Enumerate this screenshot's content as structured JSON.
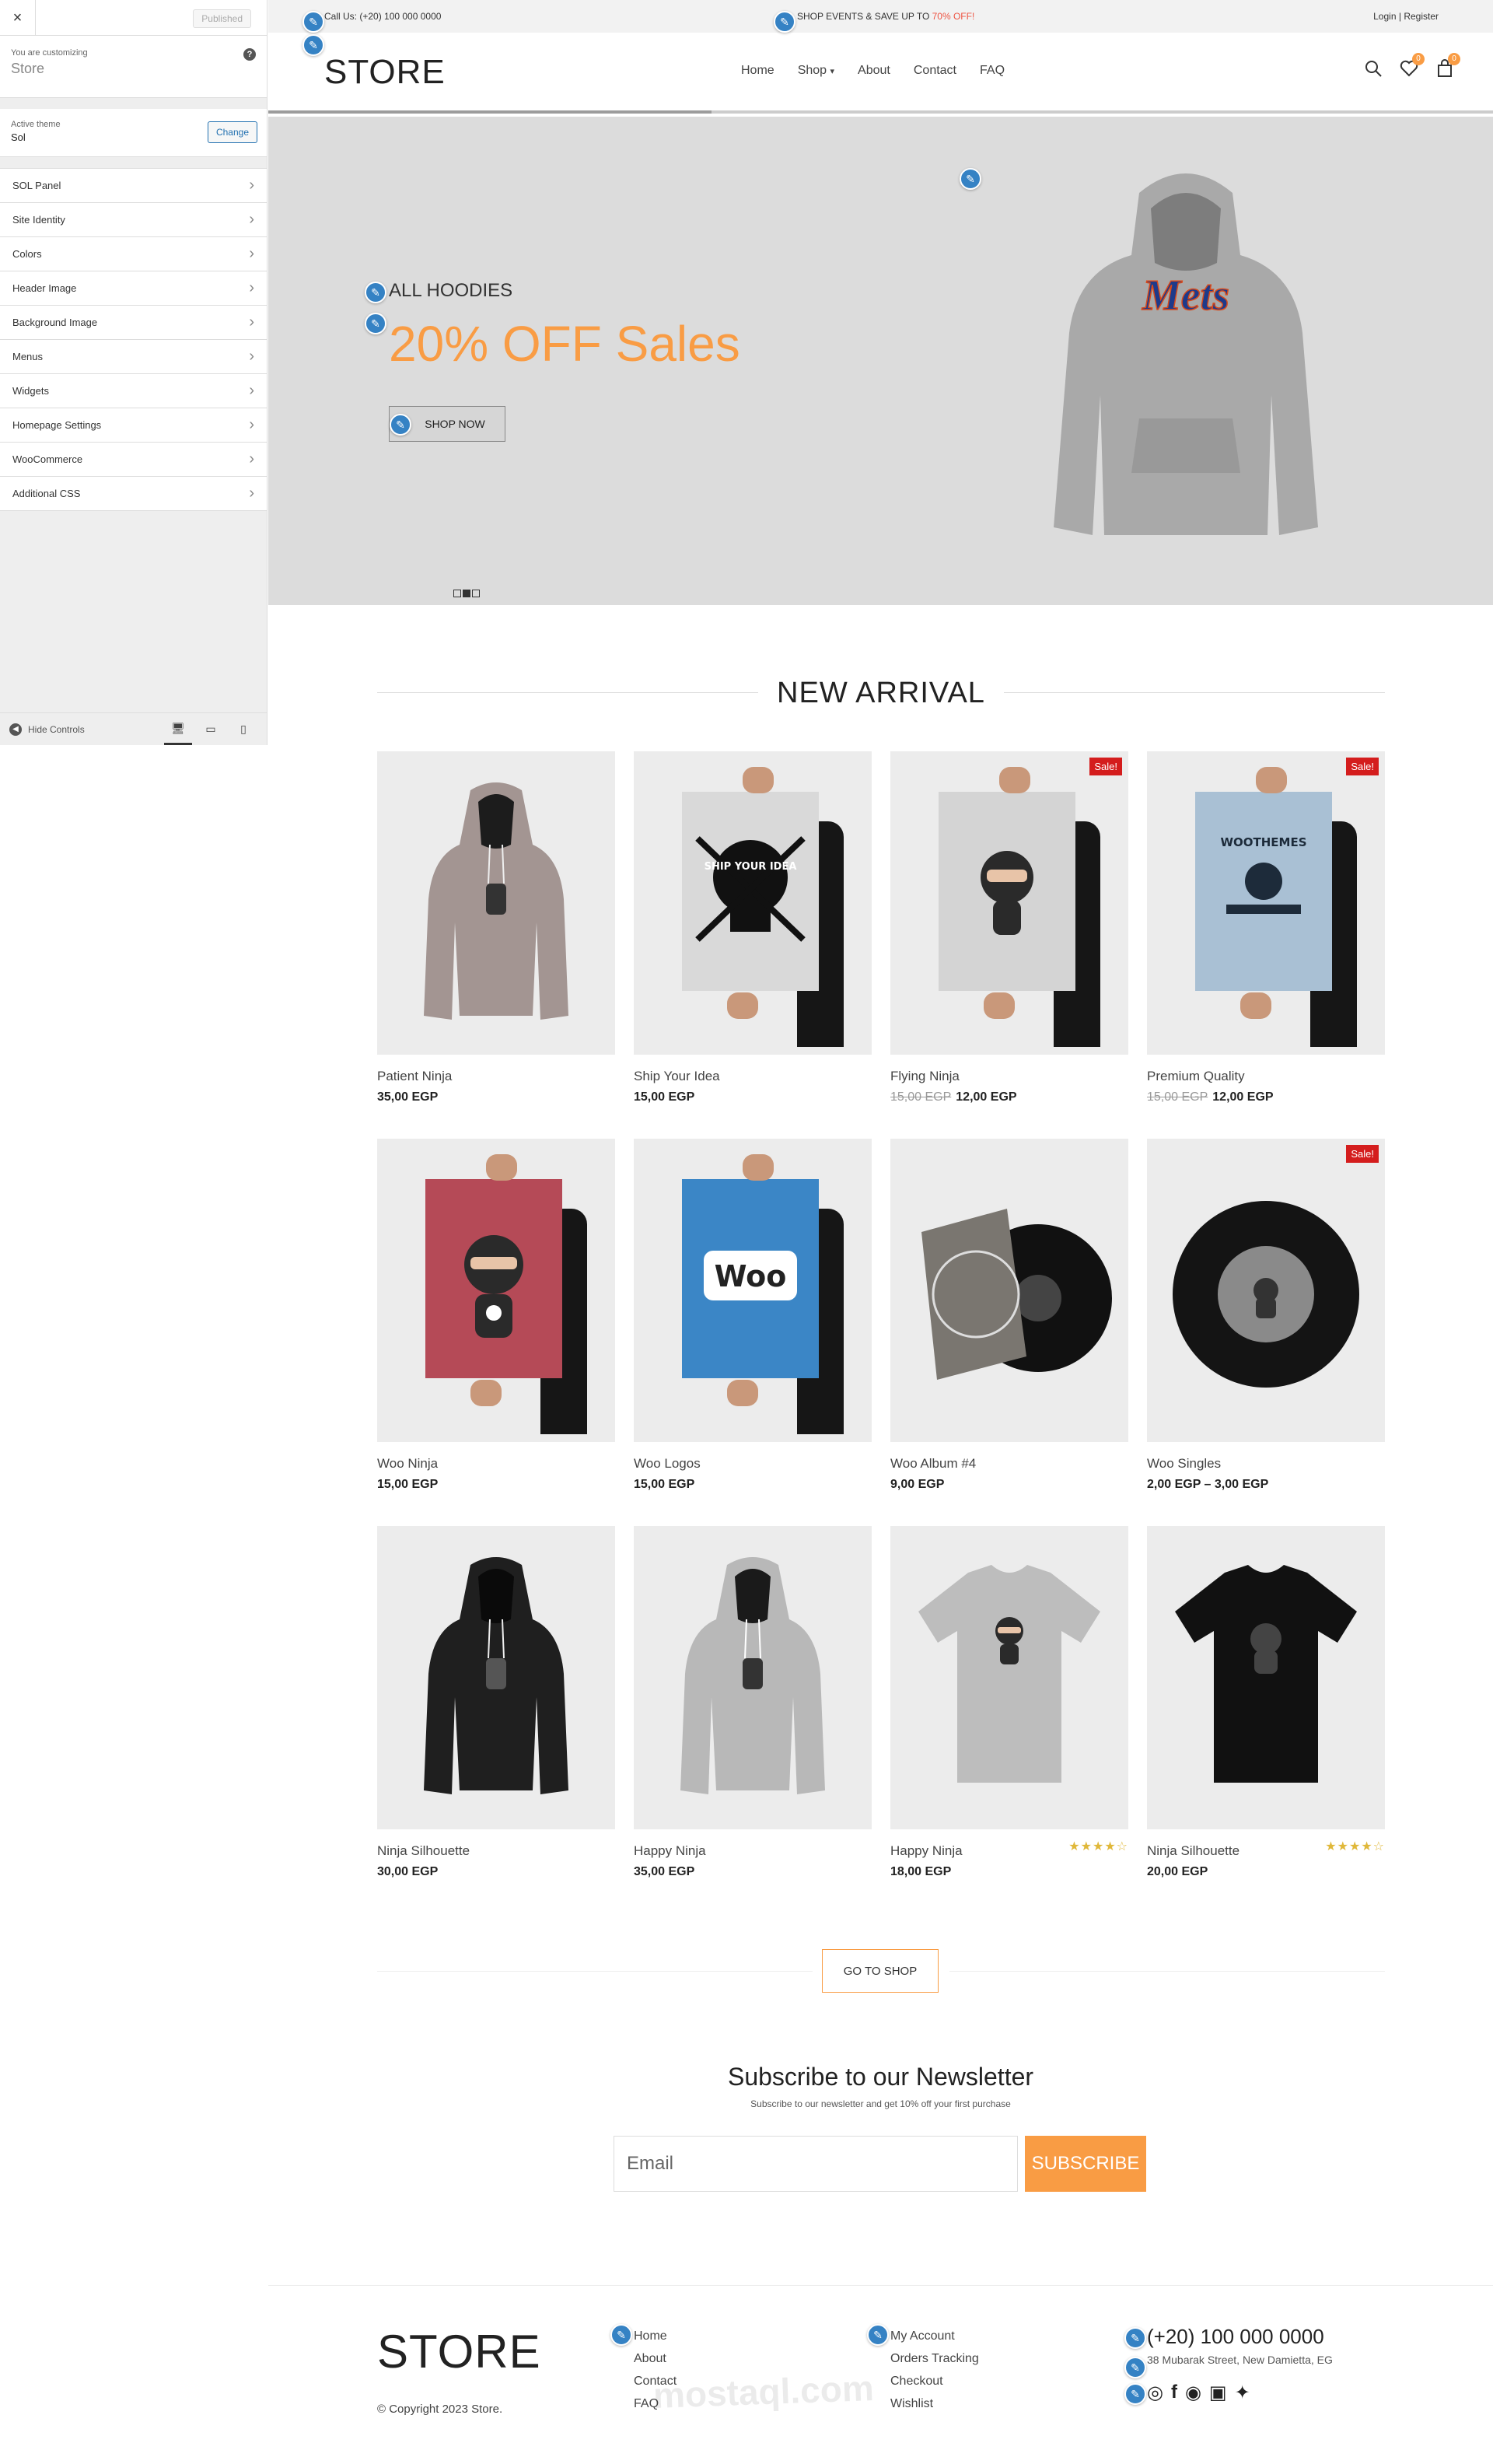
{
  "sidebar": {
    "close_label": "×",
    "published_label": "Published",
    "customizing_label": "You are customizing",
    "site_name": "Store",
    "active_theme_label": "Active theme",
    "theme_name": "Sol",
    "change_label": "Change",
    "items": [
      {
        "label": "SOL Panel"
      },
      {
        "label": "Site Identity"
      },
      {
        "label": "Colors"
      },
      {
        "label": "Header Image"
      },
      {
        "label": "Background Image"
      },
      {
        "label": "Menus"
      },
      {
        "label": "Widgets"
      },
      {
        "label": "Homepage Settings"
      },
      {
        "label": "WooCommerce"
      },
      {
        "label": "Additional CSS"
      }
    ],
    "hide_controls_label": "Hide Controls"
  },
  "topbar": {
    "call": "Call Us: (+20) 100 000 0000",
    "promo": "SHOP EVENTS & SAVE UP TO ",
    "promo_hot": "70% OFF!",
    "login": "Login",
    "separator": "|",
    "register": "Register"
  },
  "header": {
    "logo": "STORE",
    "nav": [
      "Home",
      "Shop",
      "About",
      "Contact",
      "FAQ"
    ],
    "wishlist_count": "0",
    "cart_count": "0"
  },
  "hero": {
    "subtitle": "ALL HOODIES",
    "title": "20% OFF Sales",
    "button": "SHOP NOW",
    "hoodie_text": "Mets"
  },
  "section": {
    "title": "NEW ARRIVAL"
  },
  "products": [
    {
      "name": "Patient Ninja",
      "price": "35,00 EGP",
      "old_price": "",
      "sale": false
    },
    {
      "name": "Ship Your Idea",
      "price": "15,00 EGP",
      "old_price": "",
      "sale": false
    },
    {
      "name": "Flying Ninja",
      "price": "12,00 EGP",
      "old_price": "15,00 EGP",
      "sale": true
    },
    {
      "name": "Premium Quality",
      "price": "12,00 EGP",
      "old_price": "15,00 EGP",
      "sale": true
    },
    {
      "name": "Woo Ninja",
      "price": "15,00 EGP",
      "old_price": "",
      "sale": false
    },
    {
      "name": "Woo Logos",
      "price": "15,00 EGP",
      "old_price": "",
      "sale": false
    },
    {
      "name": "Woo Album #4",
      "price": "9,00 EGP",
      "old_price": "",
      "sale": false
    },
    {
      "name": "Woo Singles",
      "price": "2,00 EGP – 3,00 EGP",
      "old_price": "",
      "sale": true
    },
    {
      "name": "Ninja Silhouette",
      "price": "30,00 EGP",
      "old_price": "",
      "sale": false
    },
    {
      "name": "Happy Ninja",
      "price": "35,00 EGP",
      "old_price": "",
      "sale": false
    },
    {
      "name": "Happy Ninja",
      "price": "18,00 EGP",
      "old_price": "",
      "sale": false,
      "rating": 4
    },
    {
      "name": "Ninja Silhouette",
      "price": "20,00 EGP",
      "old_price": "",
      "sale": false,
      "rating": 4
    }
  ],
  "sale_label": "Sale!",
  "poster_texts": {
    "ship": "SHIP YOUR IDEA",
    "woothemes": "WOOTHEMES",
    "woo": "Woo"
  },
  "go_to_shop": "GO TO SHOP",
  "newsletter": {
    "title": "Subscribe to our Newsletter",
    "subtitle": "Subscribe to our newsletter and get 10% off your first purchase",
    "placeholder": "Email",
    "button": "SUBSCRIBE"
  },
  "footer": {
    "logo": "STORE",
    "copyright": "© Copyright 2023 Store.",
    "col1": [
      "Home",
      "About",
      "Contact",
      "FAQ"
    ],
    "col2": [
      "My Account",
      "Orders Tracking",
      "Checkout",
      "Wishlist"
    ],
    "phone": "(+20) 100 000 0000",
    "address": "38 Mubarak Street, New Damietta, EG"
  },
  "watermark": "mostaql.com",
  "colors": {
    "accent": "#f99c44",
    "sale": "#d41d1d",
    "pencil": "#3582c4"
  }
}
